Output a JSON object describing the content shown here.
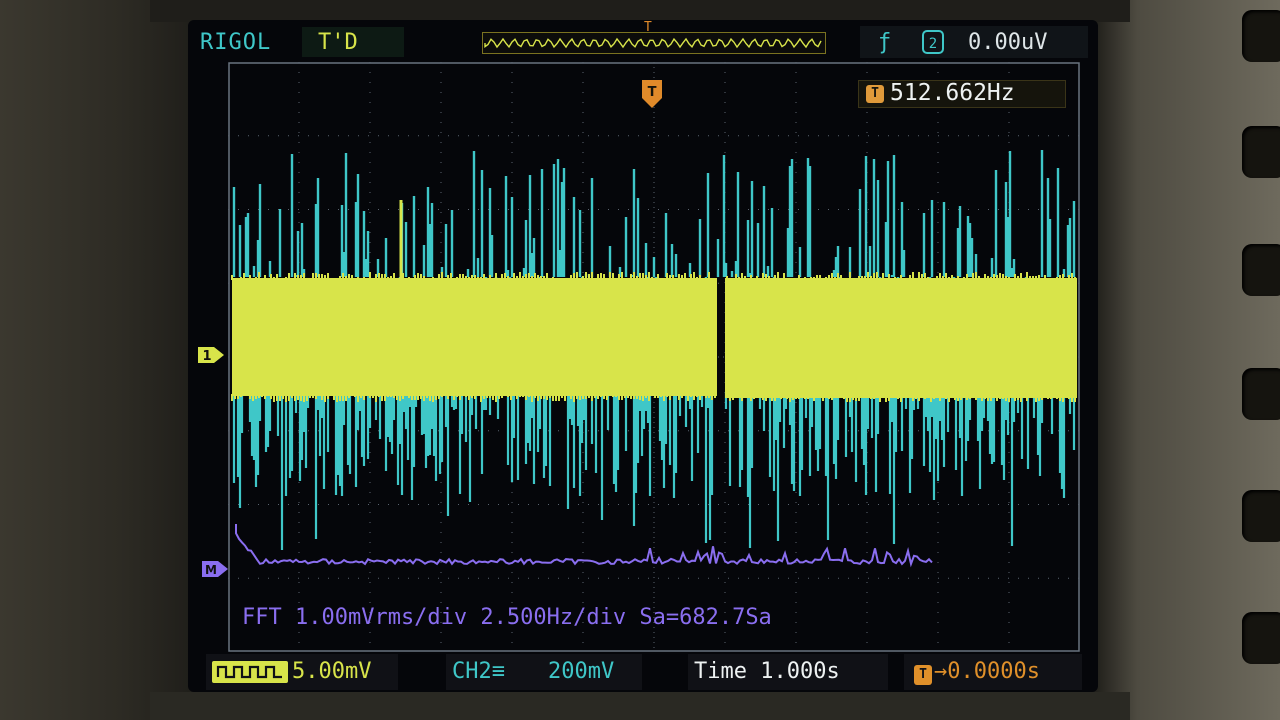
{
  "header": {
    "brand": "RIGOL",
    "trigger_status": "T'D",
    "trigger_edge_symbol": "ƒ",
    "trigger_source_symbol": "2",
    "trigger_level": "0.00uV",
    "timebar_marker": "T"
  },
  "display": {
    "frequency_icon": "T",
    "frequency": "512.662Hz",
    "trigger_marker": "T",
    "ch1_marker": "1",
    "math_marker": "M",
    "fft_label": "FFT 1.00mVrms/div 2.500Hz/div Sa=682.7Sa"
  },
  "statusbar": {
    "ch1_value": "5.00mV",
    "ch2_name": "CH2≡",
    "ch2_value": "200mV",
    "time_label": "Time",
    "time_value": "1.000s",
    "offset_icon": "T",
    "offset_value": "→0.0000s"
  },
  "colors": {
    "ch1": "#d8e44a",
    "ch2": "#3fc7c8",
    "math": "#8a6ef0",
    "trigger": "#e08a2a",
    "grid": "#5a6470",
    "screen_bg": "#05060a"
  }
}
